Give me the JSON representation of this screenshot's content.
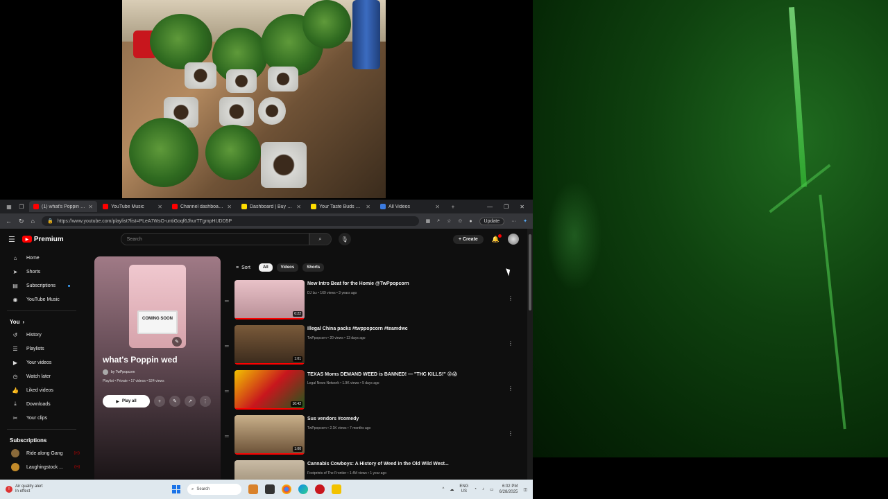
{
  "browser": {
    "tabs": [
      {
        "label": "(1) what's Poppin wed",
        "fav": "#ff0000",
        "active": true
      },
      {
        "label": "YouTube Music",
        "fav": "#ff0000",
        "active": false
      },
      {
        "label": "Channel dashboard -",
        "fav": "#ff0000",
        "active": false
      },
      {
        "label": "Dashboard | Buy Me",
        "fav": "#ffdd00",
        "active": false
      },
      {
        "label": "Your Taste Buds Fav",
        "fav": "#ffdd00",
        "active": false
      },
      {
        "label": "All Videos",
        "fav": "#3b7be0",
        "active": false
      }
    ],
    "url": "https://www.youtube.com/playlist?list=PLeA7WsO-untiGoqf6JhurTTgmpHUDD5P",
    "update_label": "Update"
  },
  "youtube": {
    "logo_text": "Premium",
    "search_placeholder": "Search",
    "create_label": "Create",
    "sidebar_main": [
      {
        "label": "Home",
        "icon": "home-icon",
        "glyph": "⌂"
      },
      {
        "label": "Shorts",
        "icon": "shorts-icon",
        "glyph": "➤"
      },
      {
        "label": "Subscriptions",
        "icon": "subscriptions-icon",
        "glyph": "▤"
      },
      {
        "label": "YouTube Music",
        "icon": "youtube-music-icon",
        "glyph": "◉"
      }
    ],
    "you_label": "You",
    "sidebar_you": [
      {
        "label": "History",
        "icon": "history-icon",
        "glyph": "↺"
      },
      {
        "label": "Playlists",
        "icon": "playlists-icon",
        "glyph": "☰"
      },
      {
        "label": "Your videos",
        "icon": "your-videos-icon",
        "glyph": "▶"
      },
      {
        "label": "Watch later",
        "icon": "watch-later-icon",
        "glyph": "◷"
      },
      {
        "label": "Liked videos",
        "icon": "liked-videos-icon",
        "glyph": "👍"
      },
      {
        "label": "Downloads",
        "icon": "downloads-icon",
        "glyph": "⤓"
      },
      {
        "label": "Your clips",
        "icon": "your-clips-icon",
        "glyph": "✂"
      }
    ],
    "subscriptions_label": "Subscriptions",
    "subscriptions": [
      {
        "label": "Ride along Gang",
        "color": "#8a6a3a"
      },
      {
        "label": "Laughingstock ...",
        "color": "#c28a2a"
      }
    ],
    "playlist": {
      "thumb_text": "COMING SOON",
      "title": "what's Poppin wed",
      "by": "by TwPpopcorn",
      "meta": "Playlist • Private • 17 videos • 524 views",
      "play_all": "Play all"
    },
    "chips": {
      "sort": "Sort",
      "items": [
        {
          "label": "All",
          "on": true
        },
        {
          "label": "Videos",
          "on": false
        },
        {
          "label": "Shorts",
          "on": false
        }
      ]
    },
    "videos": [
      {
        "title": "New Intro Beat for the Homie @TwPpopcorn",
        "meta": "DJ Izz • 169 views • 3 years ago",
        "duration": "0:22",
        "bg": "linear-gradient(180deg,#e9c2c8,#b88f97)"
      },
      {
        "title": "Illegal China packs #twppopcorn #teamdwc",
        "meta": "TwPpopcorn • 20 views • 13 days ago",
        "duration": "1:01",
        "bg": "linear-gradient(180deg,#7a5a3a,#3a2a1c)"
      },
      {
        "title": "TEXAS Moms DEMAND WEED is BANNED! — \"THC KILLS!\" 😡😱",
        "meta": "Legal News Network • 1.9K views • 5 days ago",
        "duration": "10:42",
        "bg": "linear-gradient(135deg,#f2c200 0%,#c8161d 50%,#1d5a1d 100%)"
      },
      {
        "title": "Sus vendors #comedy",
        "meta": "TwPpopcorn • 2.1K views • 7 months ago",
        "duration": "1:00",
        "bg": "linear-gradient(180deg,#c9b08a,#6a5036)"
      },
      {
        "title": "Cannabis Cowboys: A History of Weed in the Old Wild West...",
        "meta": "Footprints of The Frontier • 1.4M views • 1 year ago",
        "duration": "",
        "bg": "linear-gradient(180deg,#c9bba5,#8a7a62)"
      }
    ]
  },
  "taskbar": {
    "alert_title": "Air quality alert",
    "alert_sub": "In effect",
    "search": "Search",
    "lang": "ENG",
    "region": "US",
    "time": "6:02 PM",
    "date": "6/28/2025"
  }
}
